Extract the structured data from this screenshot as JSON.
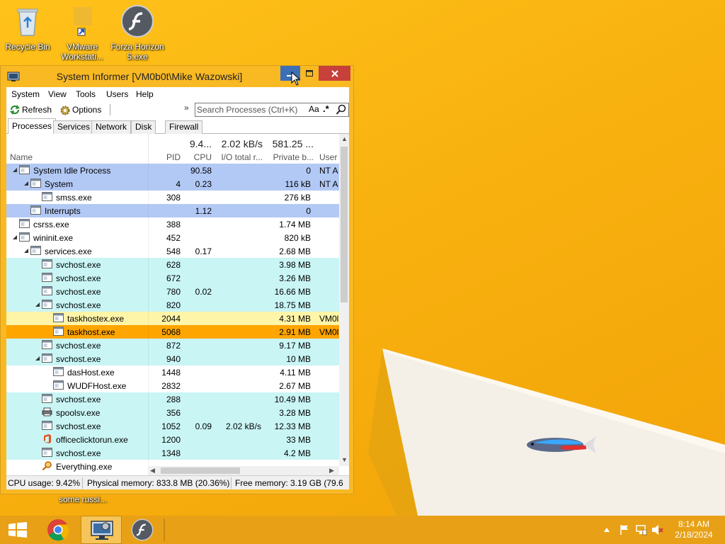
{
  "colors": {
    "desktop": "#f7b010",
    "window_frame": "#f9b923",
    "row_blue": "#b3c9f5",
    "row_cyan": "#c9f5f5",
    "row_yellow": "#fff5a8",
    "row_orange": "#ffa500",
    "minimize_hover": "#3c6fb5",
    "close": "#c7403a"
  },
  "desktop": {
    "icons": [
      {
        "label": "Recycle Bin",
        "icon": "recycle-bin-icon"
      },
      {
        "label": "VMware Workstati...",
        "icon": "vmware-icon"
      },
      {
        "label": "Forza Horizon 5.exe",
        "icon": "flash-icon"
      }
    ],
    "below_window_label": "some russi..."
  },
  "window": {
    "title": "System Informer [VM0b0t\\Mike Wazowski]",
    "menu": [
      "System",
      "View",
      "Tools",
      "Users",
      "Help"
    ],
    "toolbar": {
      "refresh": "Refresh",
      "options": "Options",
      "overflow": "»"
    },
    "search": {
      "placeholder": "Search Processes (Ctrl+K)",
      "case_label": "Aa",
      "regex_label": ".*"
    },
    "tabs": [
      "Processes",
      "Services",
      "Network",
      "Disk",
      "Firewall"
    ],
    "columns": {
      "name": "Name",
      "pid": "PID",
      "cpu": "CPU",
      "io": "I/O total r...",
      "private": "Private b...",
      "user": "User",
      "cpu_total": "9.4...",
      "io_total": "2.02 kB/s",
      "private_total": "581.25 ..."
    },
    "processes": [
      {
        "name": "System Idle Process",
        "pid": "",
        "cpu": "90.58",
        "io": "",
        "private": "0",
        "user": "NT A",
        "depth": 0,
        "toggle": "open",
        "icon": "window",
        "color": "blue"
      },
      {
        "name": "System",
        "pid": "4",
        "cpu": "0.23",
        "io": "",
        "private": "116 kB",
        "user": "NT A",
        "depth": 1,
        "toggle": "open",
        "icon": "window",
        "color": "blue"
      },
      {
        "name": "smss.exe",
        "pid": "308",
        "cpu": "",
        "io": "",
        "private": "276 kB",
        "user": "",
        "depth": 2,
        "toggle": "",
        "icon": "window",
        "color": ""
      },
      {
        "name": "Interrupts",
        "pid": "",
        "cpu": "1.12",
        "io": "",
        "private": "0",
        "user": "",
        "depth": 1,
        "toggle": "",
        "icon": "window",
        "color": "blue"
      },
      {
        "name": "csrss.exe",
        "pid": "388",
        "cpu": "",
        "io": "",
        "private": "1.74 MB",
        "user": "",
        "depth": 0,
        "toggle": "",
        "icon": "window",
        "color": ""
      },
      {
        "name": "wininit.exe",
        "pid": "452",
        "cpu": "",
        "io": "",
        "private": "820 kB",
        "user": "",
        "depth": 0,
        "toggle": "open",
        "icon": "window",
        "color": ""
      },
      {
        "name": "services.exe",
        "pid": "548",
        "cpu": "0.17",
        "io": "",
        "private": "2.68 MB",
        "user": "",
        "depth": 1,
        "toggle": "open",
        "icon": "window",
        "color": ""
      },
      {
        "name": "svchost.exe",
        "pid": "628",
        "cpu": "",
        "io": "",
        "private": "3.98 MB",
        "user": "",
        "depth": 2,
        "toggle": "",
        "icon": "window",
        "color": "cyan"
      },
      {
        "name": "svchost.exe",
        "pid": "672",
        "cpu": "",
        "io": "",
        "private": "3.26 MB",
        "user": "",
        "depth": 2,
        "toggle": "",
        "icon": "window",
        "color": "cyan"
      },
      {
        "name": "svchost.exe",
        "pid": "780",
        "cpu": "0.02",
        "io": "",
        "private": "16.66 MB",
        "user": "",
        "depth": 2,
        "toggle": "",
        "icon": "window",
        "color": "cyan"
      },
      {
        "name": "svchost.exe",
        "pid": "820",
        "cpu": "",
        "io": "",
        "private": "18.75 MB",
        "user": "",
        "depth": 2,
        "toggle": "open",
        "icon": "window",
        "color": "cyan"
      },
      {
        "name": "taskhostex.exe",
        "pid": "2044",
        "cpu": "",
        "io": "",
        "private": "4.31 MB",
        "user": "VM0l",
        "depth": 3,
        "toggle": "",
        "icon": "window",
        "color": "yellow"
      },
      {
        "name": "taskhost.exe",
        "pid": "5068",
        "cpu": "",
        "io": "",
        "private": "2.91 MB",
        "user": "VM0l",
        "depth": 3,
        "toggle": "",
        "icon": "window",
        "color": "orange"
      },
      {
        "name": "svchost.exe",
        "pid": "872",
        "cpu": "",
        "io": "",
        "private": "9.17 MB",
        "user": "",
        "depth": 2,
        "toggle": "",
        "icon": "window",
        "color": "cyan"
      },
      {
        "name": "svchost.exe",
        "pid": "940",
        "cpu": "",
        "io": "",
        "private": "10 MB",
        "user": "",
        "depth": 2,
        "toggle": "open",
        "icon": "window",
        "color": "cyan"
      },
      {
        "name": "dasHost.exe",
        "pid": "1448",
        "cpu": "",
        "io": "",
        "private": "4.11 MB",
        "user": "",
        "depth": 3,
        "toggle": "",
        "icon": "window",
        "color": ""
      },
      {
        "name": "WUDFHost.exe",
        "pid": "2832",
        "cpu": "",
        "io": "",
        "private": "2.67 MB",
        "user": "",
        "depth": 3,
        "toggle": "",
        "icon": "window",
        "color": ""
      },
      {
        "name": "svchost.exe",
        "pid": "288",
        "cpu": "",
        "io": "",
        "private": "10.49 MB",
        "user": "",
        "depth": 2,
        "toggle": "",
        "icon": "window",
        "color": "cyan"
      },
      {
        "name": "spoolsv.exe",
        "pid": "356",
        "cpu": "",
        "io": "",
        "private": "3.28 MB",
        "user": "",
        "depth": 2,
        "toggle": "",
        "icon": "printer",
        "color": "cyan"
      },
      {
        "name": "svchost.exe",
        "pid": "1052",
        "cpu": "0.09",
        "io": "2.02 kB/s",
        "private": "12.33 MB",
        "user": "",
        "depth": 2,
        "toggle": "",
        "icon": "window",
        "color": "cyan"
      },
      {
        "name": "officeclicktorun.exe",
        "pid": "1200",
        "cpu": "",
        "io": "",
        "private": "33 MB",
        "user": "",
        "depth": 2,
        "toggle": "",
        "icon": "office",
        "color": "cyan"
      },
      {
        "name": "svchost.exe",
        "pid": "1348",
        "cpu": "",
        "io": "",
        "private": "4.2 MB",
        "user": "",
        "depth": 2,
        "toggle": "",
        "icon": "window",
        "color": "cyan"
      },
      {
        "name": "Everything.exe",
        "pid": "",
        "cpu": "",
        "io": "",
        "private": "",
        "user": "",
        "depth": 2,
        "toggle": "",
        "icon": "magnifier",
        "color": ""
      }
    ],
    "status": {
      "cpu": "CPU usage: 9.42%",
      "physical": "Physical memory: 833.8 MB (20.36%)",
      "free": "Free memory: 3.19 GB (79.6"
    }
  },
  "taskbar": {
    "apps": [
      "start-icon",
      "chrome-icon",
      "system-informer-icon",
      "flash-icon"
    ],
    "time": "8:14 AM",
    "date": "2/18/2024"
  }
}
